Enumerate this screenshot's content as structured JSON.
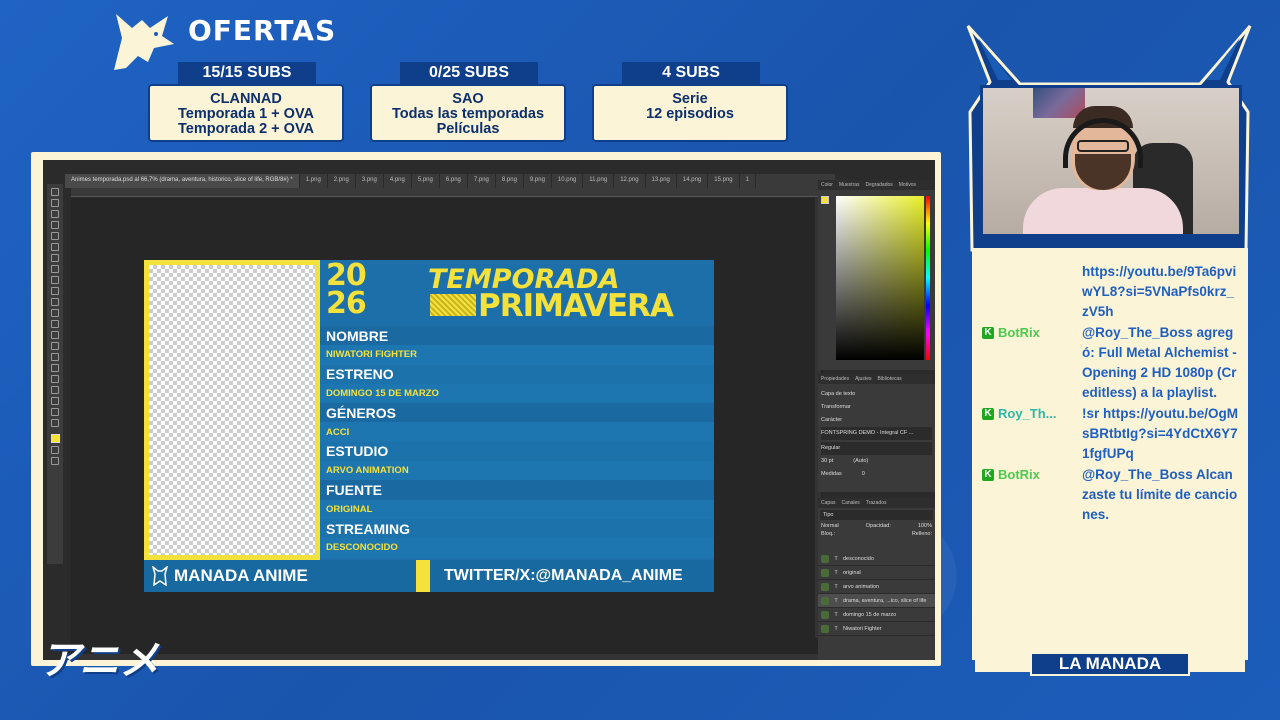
{
  "header": {
    "title": "OFERTAS"
  },
  "offers": [
    {
      "tag": "15/15 SUBS",
      "line1": "CLANNAD",
      "line2": "Temporada 1 + OVA",
      "line3": "Temporada 2 + OVA"
    },
    {
      "tag": "0/25 SUBS",
      "line1": "SAO",
      "line2": "Todas las temporadas",
      "line3": "Películas"
    },
    {
      "tag": "4 SUBS",
      "line1": "Serie",
      "line2": "12 episodios",
      "line3": ""
    }
  ],
  "photoshop": {
    "active_tab": "Animes temporada.psd al 66,7% (drama, aventura, historico, slice of life, RGB/8#) *",
    "tabs": [
      "1.png",
      "2.png",
      "3.png",
      "4.png",
      "5.png",
      "6.png",
      "7.png",
      "8.png",
      "9.png",
      "10.png",
      "11.png",
      "12.png",
      "13.png",
      "14.png",
      "15.png",
      "1"
    ],
    "panels": {
      "color_tabs": [
        "Color",
        "Muestras",
        "Degradados",
        "Motivos"
      ],
      "props_tabs": [
        "Propiedades",
        "Ajustes",
        "Bibliotecas"
      ],
      "props_layer": "Capa de texto",
      "transform": "Transformar",
      "character": "Carácter",
      "font": "FONTSPRING DEMO - Integral CF ...",
      "style": "Regular",
      "size": "30 pt",
      "leading": "(Auto)",
      "kerning": "Medidas",
      "tracking": "0",
      "layers_tabs": [
        "Capas",
        "Canales",
        "Trazados"
      ],
      "layer_search": "Tipo",
      "blend": "Normal",
      "opacity_label": "Opacidad:",
      "opacity": "100%",
      "lock_label": "Bloq.:",
      "fill_label": "Relleno:",
      "layers": [
        "desconocido",
        "original",
        "arvo animation",
        "drama, aventura, ...ico, slice of life",
        "domingo 15 de marzo",
        "Niwatori Fighter"
      ]
    }
  },
  "design": {
    "year_top": "20",
    "year_bottom": "26",
    "temporada": "TEMPORADA",
    "primavera": "PRIMAVERA",
    "rows": [
      {
        "kind": "lab",
        "text": "NOMBRE"
      },
      {
        "kind": "val",
        "text": "NIWATORI FIGHTER"
      },
      {
        "kind": "lab",
        "text": "ESTRENO"
      },
      {
        "kind": "val",
        "text": "DOMINGO 15 DE MARZO"
      },
      {
        "kind": "lab",
        "text": "GÉNEROS"
      },
      {
        "kind": "val",
        "text": "ACCI"
      },
      {
        "kind": "lab",
        "text": "ESTUDIO"
      },
      {
        "kind": "val",
        "text": "ARVO ANIMATION"
      },
      {
        "kind": "lab",
        "text": "FUENTE"
      },
      {
        "kind": "val",
        "text": "ORIGINAL"
      },
      {
        "kind": "lab",
        "text": "STREAMING"
      },
      {
        "kind": "val",
        "text": "DESCONOCIDO"
      }
    ],
    "brand": "MANADA ANIME",
    "twitter": "TWITTER/X:@MANADA_ANIME"
  },
  "chat": [
    {
      "badge": "",
      "user": "",
      "text": "https://youtu.be/9Ta6pviwYL8?si=5VNaPfs0krz_zV5h"
    },
    {
      "badge": "K",
      "user": "BotRix",
      "text": "@Roy_The_Boss agregó: Full Metal Alchemist - Opening 2 HD 1080p (Creditless) a la playlist."
    },
    {
      "badge": "K",
      "user": "Roy_Th...",
      "text": "!sr https://youtu.be/OgMsBRtbtIg?si=4YdCtX6Y71fgfUPq"
    },
    {
      "badge": "K",
      "user": "BotRix",
      "text": "@Roy_The_Boss Alcanzaste tu límite de canciones."
    }
  ],
  "footer_label": "LA MANADA",
  "corner_text": "アニメ",
  "colors": {
    "bg": "#1a5bb5",
    "cream": "#fbf4d6",
    "navy": "#0f3f8a",
    "yellow": "#f5e13b",
    "design_blue": "#1c6fa8"
  }
}
